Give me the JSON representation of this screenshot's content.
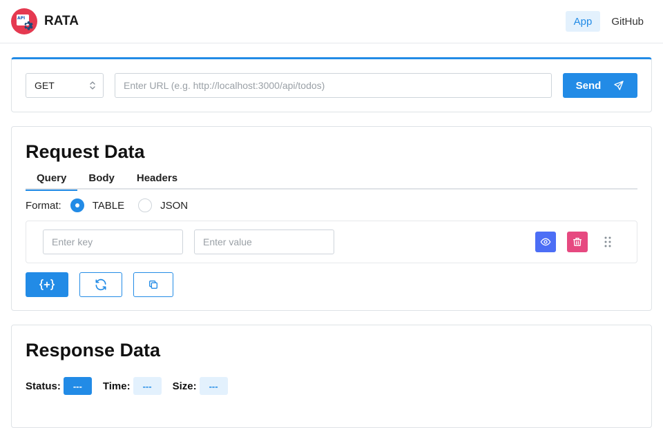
{
  "navbar": {
    "brand": "RATA",
    "logo_text": "API",
    "links": [
      {
        "label": "App",
        "active": true
      },
      {
        "label": "GitHub",
        "active": false
      }
    ]
  },
  "request_bar": {
    "method": "GET",
    "url_value": "",
    "url_placeholder": "Enter URL (e.g. http://localhost:3000/api/todos)",
    "send_label": "Send",
    "send_icon": "paper-plane-icon"
  },
  "request_data": {
    "title": "Request Data",
    "tabs": [
      {
        "label": "Query",
        "active": true
      },
      {
        "label": "Body",
        "active": false
      },
      {
        "label": "Headers",
        "active": false
      }
    ],
    "format_label": "Format:",
    "format_options": [
      {
        "label": "TABLE",
        "checked": true
      },
      {
        "label": "JSON",
        "checked": false
      }
    ],
    "row": {
      "key_placeholder": "Enter key",
      "value_placeholder": "Enter value"
    },
    "tool_icons": [
      "add-variable-icon",
      "refresh-icon",
      "copy-icon"
    ]
  },
  "response_data": {
    "title": "Response Data",
    "status_label": "Status:",
    "status_value": "---",
    "time_label": "Time:",
    "time_value": "---",
    "size_label": "Size:",
    "size_value": "---"
  },
  "colors": {
    "primary": "#228be6",
    "primary_light": "#e3f1fd",
    "indigo": "#4c6ef5",
    "pink": "#e64980",
    "logo_red": "#e53950"
  }
}
